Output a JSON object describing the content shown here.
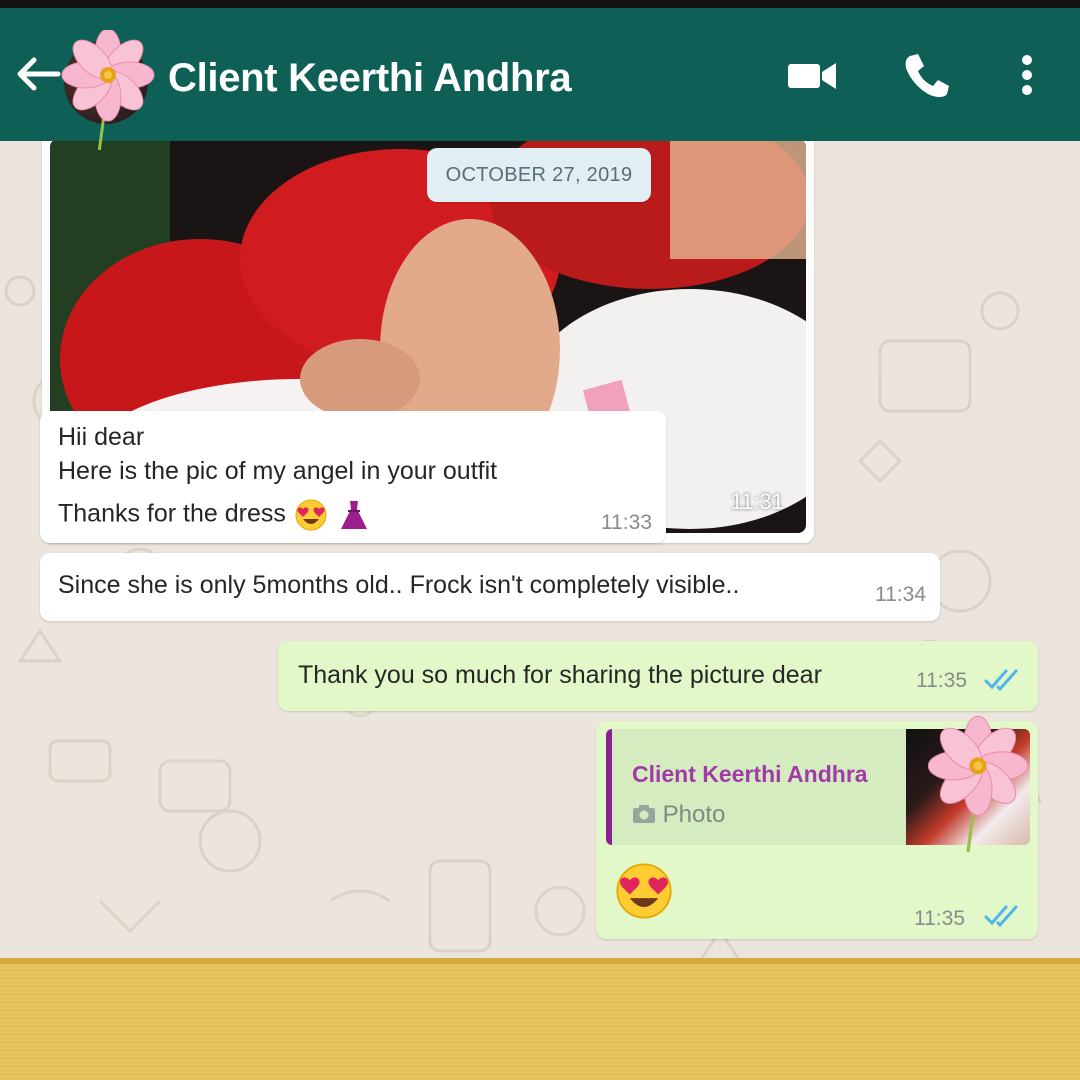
{
  "header": {
    "contact_name": "Client Keerthi Andhra",
    "back_icon": "arrow-left-icon",
    "video_icon": "video-call-icon",
    "call_icon": "phone-icon",
    "menu_icon": "more-vertical-icon",
    "bg_color": "#0e5f55"
  },
  "chat": {
    "date_chip": "OCTOBER 27, 2019",
    "messages": [
      {
        "type": "photo",
        "direction": "incoming",
        "time": "11:31"
      },
      {
        "type": "text",
        "direction": "incoming",
        "lines": [
          "Hii dear",
          "Here is the pic of my angel in your outfit",
          "Thanks for the dress"
        ],
        "emojis": [
          "heart-eyes-emoji",
          "dress-emoji"
        ],
        "time": "11:33"
      },
      {
        "type": "text",
        "direction": "incoming",
        "text": "Since she is only 5months old.. Frock isn't completely visible..",
        "time": "11:34"
      },
      {
        "type": "text",
        "direction": "outgoing",
        "text": "Thank you so much for sharing the picture dear",
        "time": "11:35",
        "status": "read"
      },
      {
        "type": "reply",
        "direction": "outgoing",
        "quoted_name": "Client Keerthi Andhra",
        "quoted_type": "Photo",
        "emoji": "heart-eyes-emoji",
        "time": "11:35",
        "status": "read"
      }
    ]
  },
  "colors": {
    "outgoing_bubble": "#e2f8c8",
    "incoming_bubble": "#ffffff",
    "read_ticks": "#4fb6ec",
    "quote_accent": "#8a1f8f",
    "footer_gold": "#e8c560"
  }
}
